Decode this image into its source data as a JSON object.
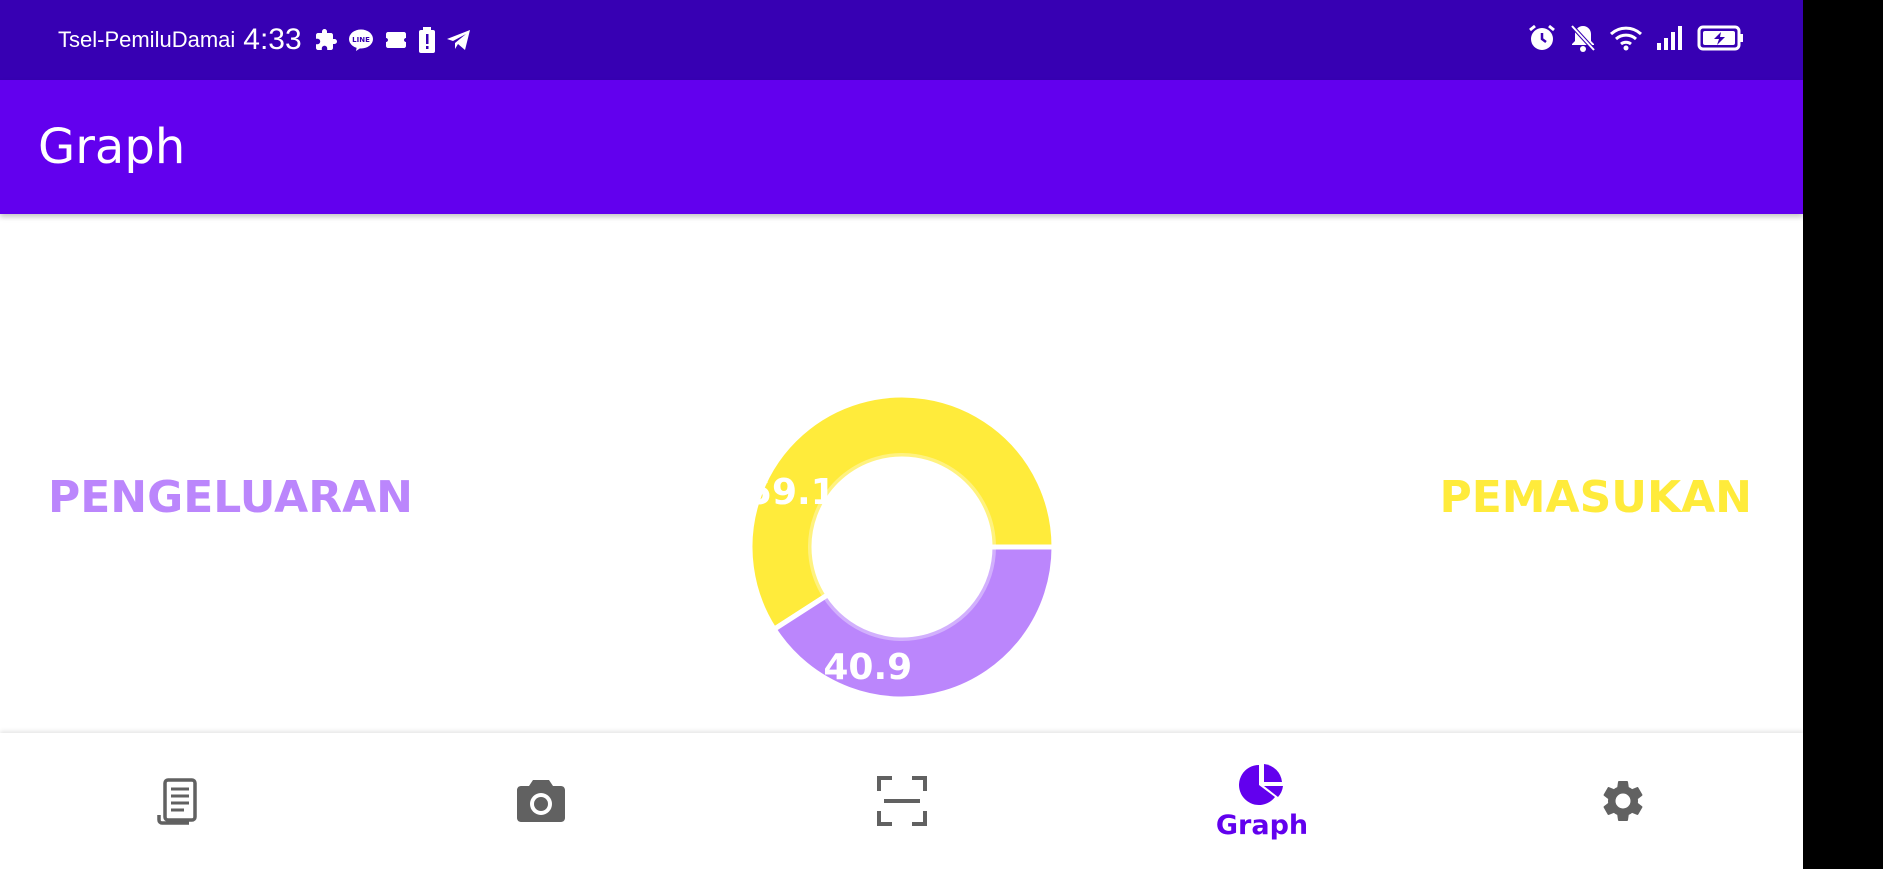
{
  "status_bar": {
    "carrier": "Tsel-PemiluDamai",
    "time": "4:33",
    "left_icons": [
      "puzzle-icon",
      "line-app-icon",
      "ticket-icon",
      "battery-alert-icon",
      "telegram-icon"
    ],
    "right_icons": [
      "alarm-icon",
      "bell-off-icon",
      "wifi-icon",
      "signal-icon",
      "battery-charging-icon"
    ]
  },
  "app_bar": {
    "title": "Graph"
  },
  "graph": {
    "left_label": "PENGELUARAN",
    "right_label": "PEMASUKAN"
  },
  "chart_data": {
    "type": "pie",
    "style": "donut",
    "slices": [
      {
        "label": "PEMASUKAN",
        "value": 59.1,
        "value_label": "59.1",
        "color": "#ffeb3b"
      },
      {
        "label": "PENGELUARAN",
        "value": 40.9,
        "value_label": "40.9",
        "color": "#bb86fc"
      }
    ]
  },
  "bottom_nav": {
    "items": [
      {
        "icon": "receipt-icon",
        "label": ""
      },
      {
        "icon": "camera-icon",
        "label": ""
      },
      {
        "icon": "scan-icon",
        "label": ""
      },
      {
        "icon": "pie-chart-icon",
        "label": "Graph",
        "selected": true
      },
      {
        "icon": "settings-icon",
        "label": ""
      }
    ]
  },
  "colors": {
    "status_bar": "#3700b3",
    "app_bar": "#6200ee",
    "expense": "#bb86fc",
    "income": "#ffeb3b",
    "nav_selected": "#6200ee",
    "nav_icon": "#616161"
  }
}
